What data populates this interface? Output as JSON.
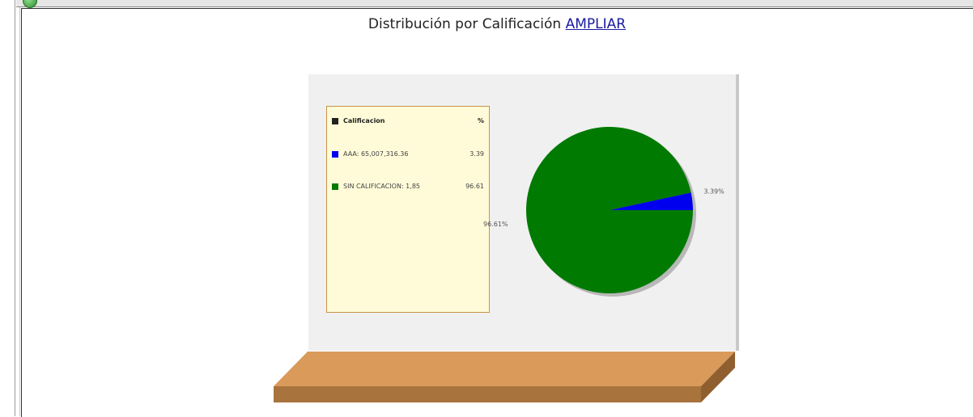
{
  "header": {
    "title": "Distribución por Calificación",
    "link_label": "AMPLIAR"
  },
  "legend": {
    "header_label": "Calificacion",
    "header_value": "%",
    "items": [
      {
        "label": "AAA: 65,007,316.36",
        "value": "3.39",
        "color": "#0000ee"
      },
      {
        "label": "SIN CALIFICACION: 1,85",
        "value": "96.61",
        "color": "#007a00"
      }
    ]
  },
  "chart_data": {
    "type": "pie",
    "title": "Distribución por Calificación",
    "slices": [
      {
        "name": "AAA",
        "value": 3.39,
        "label": "3.39%",
        "color": "#0000ee"
      },
      {
        "name": "SIN CALIFICACION",
        "value": 96.61,
        "label": "96.61%",
        "color": "#007a00"
      }
    ]
  },
  "colors": {
    "board": "#f0f0f0",
    "legend_bg": "#fffbd8",
    "legend_border": "#c9944a",
    "shelf_top": "#d99a5a",
    "shelf_side": "#a8733d"
  }
}
